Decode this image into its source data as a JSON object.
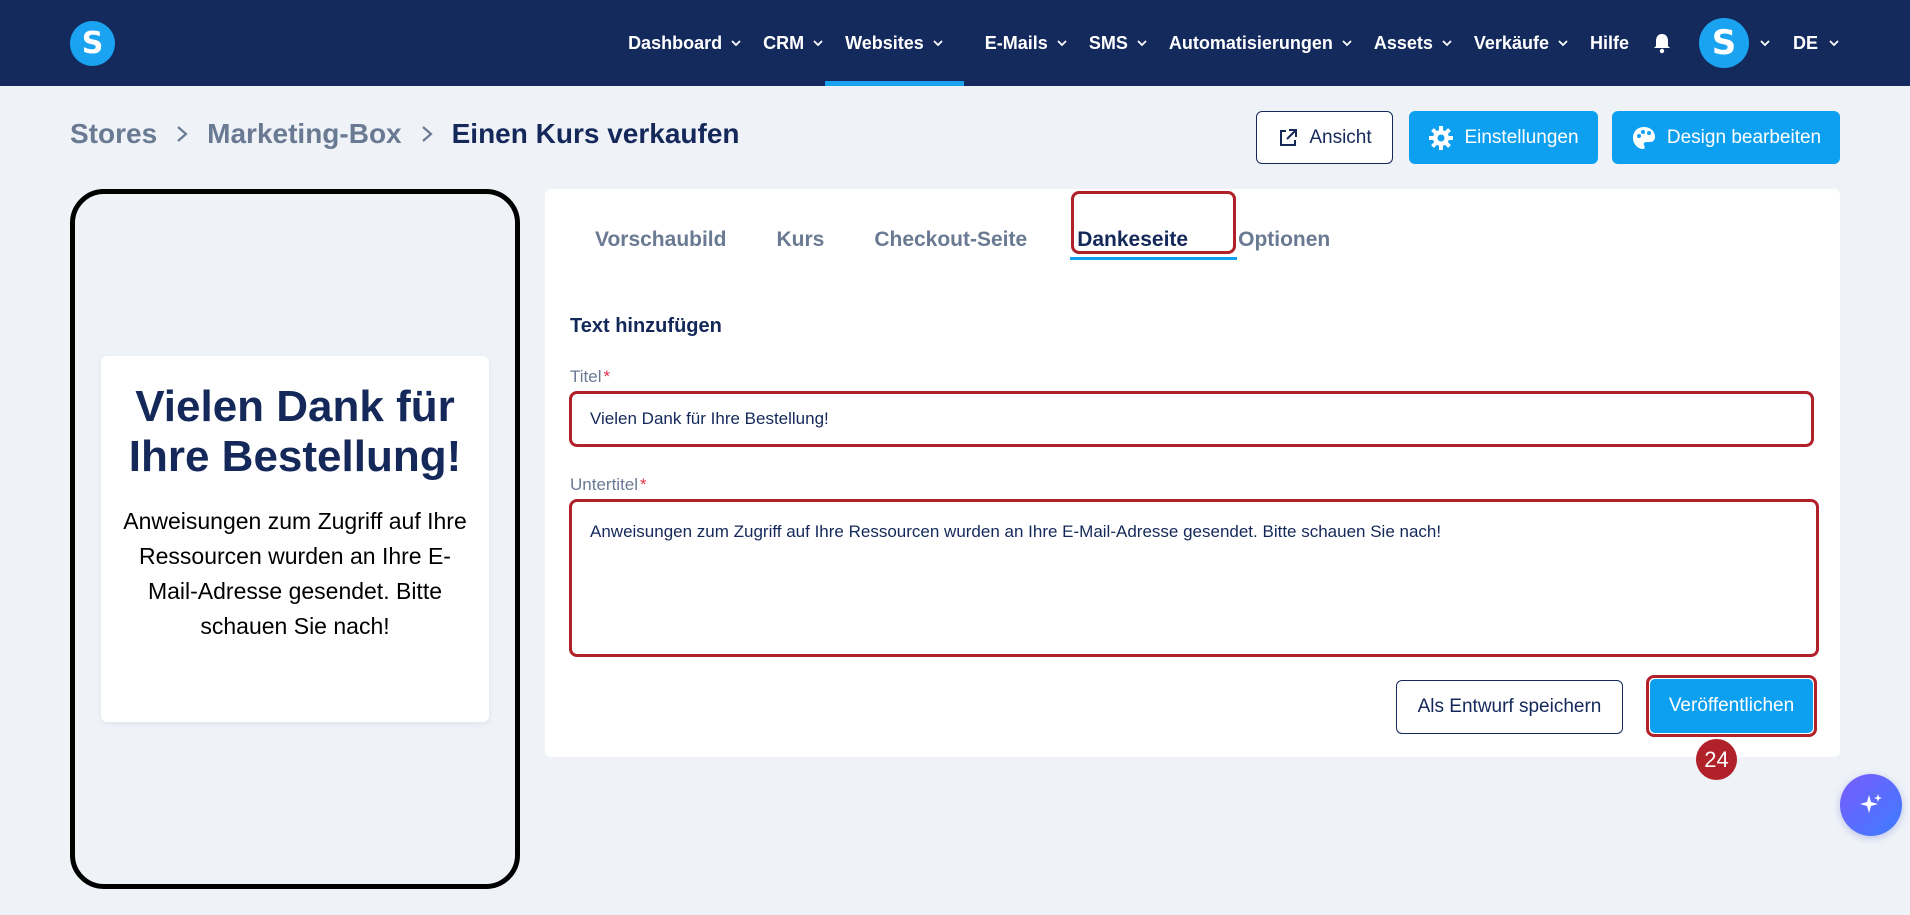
{
  "app": {
    "logo_letter": "S"
  },
  "nav": {
    "items": [
      {
        "label": "Dashboard",
        "has_chevron": true
      },
      {
        "label": "CRM",
        "has_chevron": true
      },
      {
        "label": "Websites",
        "has_chevron": true,
        "active": true
      },
      {
        "label": "E-Mails",
        "has_chevron": true
      },
      {
        "label": "SMS",
        "has_chevron": true
      },
      {
        "label": "Automatisierungen",
        "has_chevron": true
      },
      {
        "label": "Assets",
        "has_chevron": true
      },
      {
        "label": "Verkäufe",
        "has_chevron": true
      },
      {
        "label": "Hilfe",
        "has_chevron": false
      }
    ],
    "avatar_letter": "S",
    "language": "DE"
  },
  "breadcrumb": [
    "Stores",
    "Marketing-Box",
    "Einen Kurs verkaufen"
  ],
  "header_buttons": {
    "view_label": "Ansicht",
    "settings_label": "Einstellungen",
    "design_label": "Design bearbeiten"
  },
  "preview": {
    "title": "Vielen Dank für Ihre Bestellung!",
    "subtitle": "Anweisungen zum Zugriff auf Ihre Ressourcen wurden an Ihre E-Mail-Adresse gesendet. Bitte schauen Sie nach!"
  },
  "tabs": [
    "Vorschaubild",
    "Kurs",
    "Checkout-Seite",
    "Dankeseite",
    "Optionen"
  ],
  "active_tab": "Dankeseite",
  "form": {
    "section_title": "Text hinzufügen",
    "title_label": "Titel",
    "title_value": "Vielen Dank für Ihre Bestellung!",
    "subtitle_label": "Untertitel",
    "subtitle_value": "Anweisungen zum Zugriff auf Ihre Ressourcen wurden an Ihre E-Mail-Adresse gesendet. Bitte schauen Sie nach!",
    "required_mark": "*",
    "draft_label": "Als Entwurf speichern",
    "publish_label": "Veröffentlichen"
  },
  "step_badge": "24",
  "colors": {
    "nav_bg": "#142a5c",
    "accent": "#0ea0f0",
    "highlight": "#b0212a",
    "page_bg": "#eff3f8"
  }
}
